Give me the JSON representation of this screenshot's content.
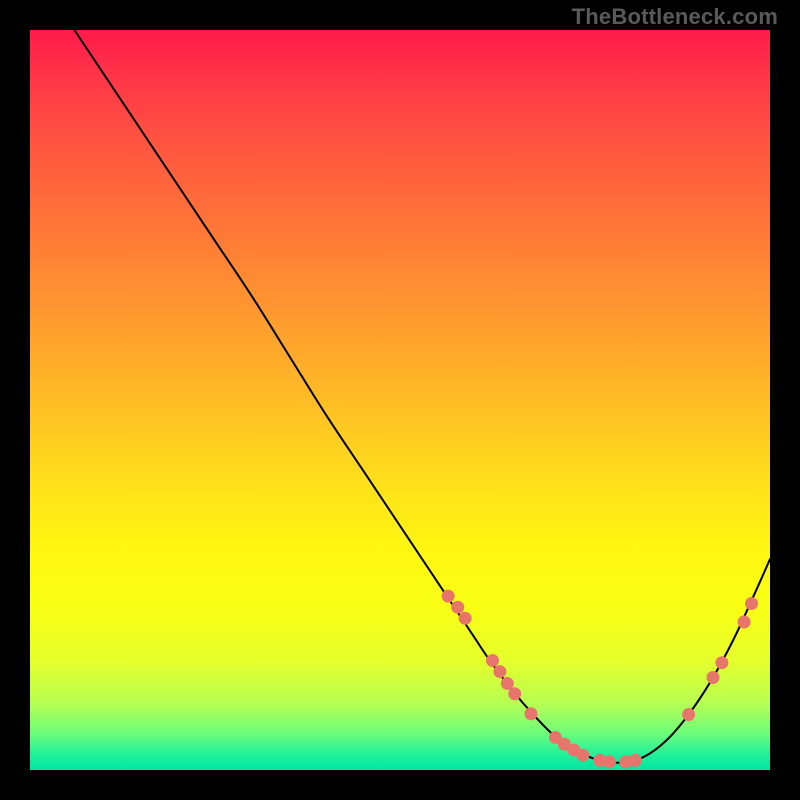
{
  "watermark": "TheBottleneck.com",
  "colors": {
    "dot": "#e8756c",
    "line": "#000000",
    "frame": "#000000"
  },
  "chart_data": {
    "type": "line",
    "title": "",
    "xlabel": "",
    "ylabel": "",
    "xlim": [
      0,
      100
    ],
    "ylim": [
      0,
      100
    ],
    "grid": false,
    "legend": false,
    "series": [
      {
        "name": "curve",
        "x": [
          6,
          10,
          15,
          20,
          25,
          30,
          35,
          40,
          45,
          50,
          54,
          57,
          60,
          62,
          65,
          68,
          71,
          74,
          77,
          80,
          83,
          86,
          89,
          92,
          95,
          98,
          100
        ],
        "y": [
          100,
          94,
          86.5,
          79,
          71.5,
          64,
          56,
          48,
          40.5,
          33,
          27,
          22.5,
          18,
          15,
          11,
          7.5,
          4.5,
          2.5,
          1.3,
          1,
          1.8,
          4,
          7.5,
          12,
          17.5,
          24,
          28.5
        ]
      }
    ],
    "markers": {
      "name": "highlight-dots",
      "points": [
        {
          "x": 56.5,
          "y": 23.5
        },
        {
          "x": 57.8,
          "y": 22.0
        },
        {
          "x": 58.8,
          "y": 20.5
        },
        {
          "x": 62.5,
          "y": 14.8
        },
        {
          "x": 63.5,
          "y": 13.3
        },
        {
          "x": 64.5,
          "y": 11.7
        },
        {
          "x": 65.5,
          "y": 10.3
        },
        {
          "x": 67.7,
          "y": 7.6
        },
        {
          "x": 71.0,
          "y": 4.4
        },
        {
          "x": 72.2,
          "y": 3.5
        },
        {
          "x": 73.5,
          "y": 2.7
        },
        {
          "x": 74.7,
          "y": 2.0
        },
        {
          "x": 77.0,
          "y": 1.3
        },
        {
          "x": 78.3,
          "y": 1.1
        },
        {
          "x": 80.5,
          "y": 1.1
        },
        {
          "x": 81.8,
          "y": 1.3
        },
        {
          "x": 89.0,
          "y": 7.5
        },
        {
          "x": 92.3,
          "y": 12.5
        },
        {
          "x": 93.5,
          "y": 14.5
        },
        {
          "x": 96.5,
          "y": 20.0
        },
        {
          "x": 97.5,
          "y": 22.5
        }
      ]
    }
  }
}
